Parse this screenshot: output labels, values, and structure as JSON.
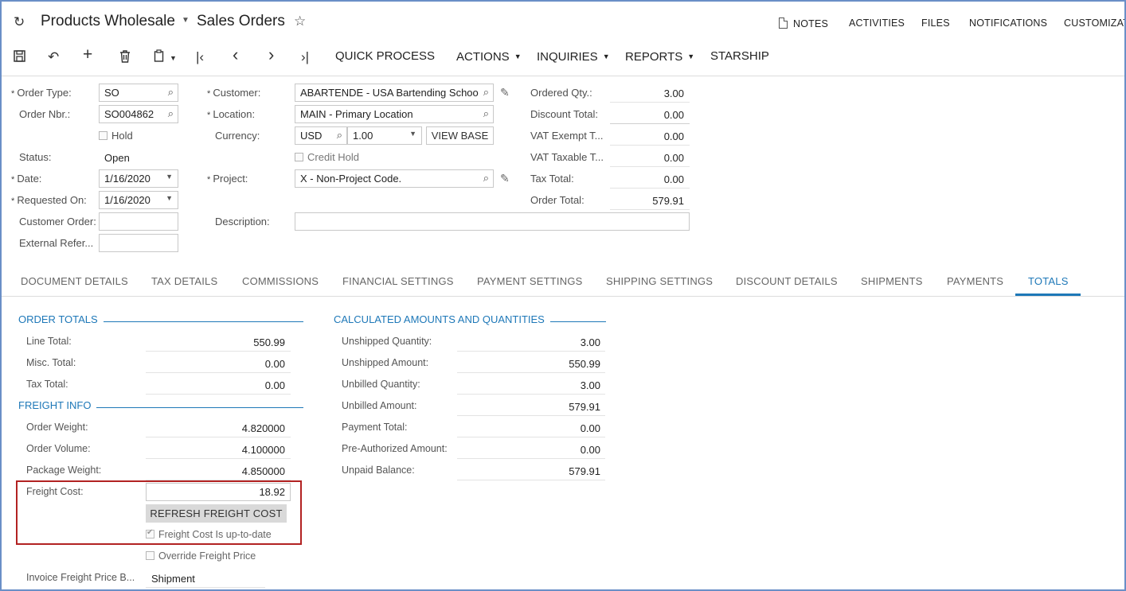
{
  "header": {
    "company": "Products Wholesale",
    "screen": "Sales Orders",
    "links": {
      "notes": "NOTES",
      "activities": "ACTIVITIES",
      "files": "FILES",
      "notifications": "NOTIFICATIONS",
      "customization": "CUSTOMIZAT"
    }
  },
  "toolbar": {
    "quick_process": "QUICK PROCESS",
    "actions": "ACTIONS",
    "inquiries": "INQUIRIES",
    "reports": "REPORTS",
    "starship": "STARSHIP"
  },
  "form": {
    "order_type_label": "Order Type:",
    "order_type": "SO",
    "order_nbr_label": "Order Nbr.:",
    "order_nbr": "SO004862",
    "hold_label": "Hold",
    "status_label": "Status:",
    "status": "Open",
    "date_label": "Date:",
    "date": "1/16/2020",
    "requested_on_label": "Requested On:",
    "requested_on": "1/16/2020",
    "customer_order_label": "Customer Order:",
    "external_ref_label": "External Refer...",
    "customer_label": "Customer:",
    "customer": "ABARTENDE - USA Bartending Schoo",
    "location_label": "Location:",
    "location": "MAIN - Primary Location",
    "currency_label": "Currency:",
    "currency": "USD",
    "rate": "1.00",
    "view_base": "VIEW BASE",
    "credit_hold_label": "Credit Hold",
    "project_label": "Project:",
    "project": "X - Non-Project Code.",
    "description_label": "Description:",
    "ordered_qty_label": "Ordered Qty.:",
    "ordered_qty": "3.00",
    "discount_total_label": "Discount Total:",
    "discount_total": "0.00",
    "vat_exempt_label": "VAT Exempt T...",
    "vat_exempt": "0.00",
    "vat_taxable_label": "VAT Taxable T...",
    "vat_taxable": "0.00",
    "tax_total_label": "Tax Total:",
    "tax_total": "0.00",
    "order_total_label": "Order Total:",
    "order_total": "579.91"
  },
  "tabs": [
    "DOCUMENT DETAILS",
    "TAX DETAILS",
    "COMMISSIONS",
    "FINANCIAL SETTINGS",
    "PAYMENT SETTINGS",
    "SHIPPING SETTINGS",
    "DISCOUNT DETAILS",
    "SHIPMENTS",
    "PAYMENTS",
    "TOTALS"
  ],
  "totals": {
    "order_totals_title": "ORDER TOTALS",
    "line_total_label": "Line Total:",
    "line_total": "550.99",
    "misc_total_label": "Misc. Total:",
    "misc_total": "0.00",
    "tax_total_label": "Tax Total:",
    "tax_total": "0.00",
    "freight_info_title": "FREIGHT INFO",
    "order_weight_label": "Order Weight:",
    "order_weight": "4.820000",
    "order_volume_label": "Order Volume:",
    "order_volume": "4.100000",
    "package_weight_label": "Package Weight:",
    "package_weight": "4.850000",
    "freight_cost_label": "Freight Cost:",
    "freight_cost": "18.92",
    "refresh_freight": "REFRESH FREIGHT COST",
    "freight_uptodate_label": "Freight Cost Is up-to-date",
    "override_freight_label": "Override Freight Price",
    "invoice_freight_label": "Invoice Freight Price B...",
    "invoice_freight": "Shipment",
    "calc_title": "CALCULATED AMOUNTS AND QUANTITIES",
    "unshipped_qty_label": "Unshipped Quantity:",
    "unshipped_qty": "3.00",
    "unshipped_amt_label": "Unshipped Amount:",
    "unshipped_amt": "550.99",
    "unbilled_qty_label": "Unbilled Quantity:",
    "unbilled_qty": "3.00",
    "unbilled_amt_label": "Unbilled Amount:",
    "unbilled_amt": "579.91",
    "payment_total_label": "Payment Total:",
    "payment_total": "0.00",
    "preauth_label": "Pre-Authorized Amount:",
    "preauth": "0.00",
    "unpaid_label": "Unpaid Balance:",
    "unpaid": "579.91"
  }
}
